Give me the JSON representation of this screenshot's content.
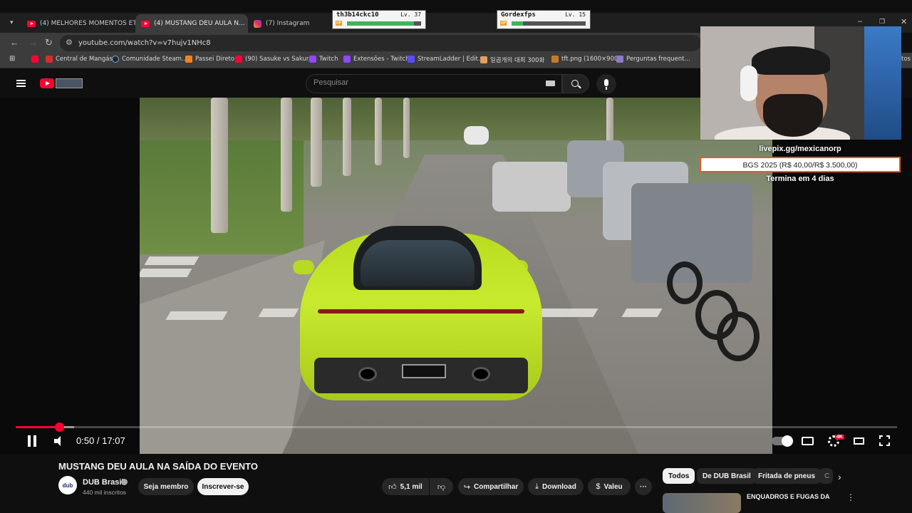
{
  "browser": {
    "tabs": [
      {
        "label": "(4) MELHORES MOMENTOS ET...",
        "favicon": "youtube-icon"
      },
      {
        "label": "(4) MUSTANG DEU AULA N...",
        "favicon": "youtube-icon"
      },
      {
        "label": "(7) Instagram",
        "favicon": "instagram-icon"
      }
    ],
    "url": "youtube.com/watch?v=v7hujv1NHc8",
    "bookmarks": [
      "Central de Mangás",
      "Comunidade Steam...",
      "Passei Direto",
      "(90) Sasuke vs Sakur...",
      "Twitch",
      "Extensões - Twitch",
      "StreamLadder | Edit...",
      "일곱개의 대죄 300화",
      "tft.png (1600×900)",
      "Perguntas frequent...",
      "tos"
    ]
  },
  "youtube": {
    "search_placeholder": "Pesquisar"
  },
  "overlay": {
    "pets": [
      {
        "name": "th3b14ckc10",
        "level": "Lv. 37",
        "hp_label": "HP",
        "hp_fraction": 0.9
      },
      {
        "name": "Gordexfps",
        "level": "Lv. 15",
        "hp_label": "HP",
        "hp_fraction": 0.15
      }
    ],
    "livepix_url": "livepix.gg/mexicanorp",
    "goal_text": "BGS 2025 (R$ 40,00/R$ 3.500,00)",
    "goal_ends": "Termina em 4 dias",
    "goal_color": "#e05a2a"
  },
  "player": {
    "time": "0:50 / 17:07",
    "progress_played_fraction": 0.049,
    "progress_loaded_fraction": 0.066,
    "quality_badge": "4K",
    "accent_color": "#ff0033"
  },
  "video": {
    "title": "MUSTANG DEU AULA NA SAÍDA DO EVENTO",
    "channel": "DUB Brasil",
    "channel_avatar_text": "dub",
    "subscribers": "440 mil inscritos",
    "join_label": "Seja membro",
    "subscribe_label": "Inscrever-se",
    "likes": "5,1 mil",
    "share_label": "Compartilhar",
    "download_label": "Download",
    "thanks_label": "Valeu",
    "more_label": "···"
  },
  "sidebar": {
    "chips": [
      "Todos",
      "De DUB Brasil",
      "Fritada de pneus",
      "C"
    ],
    "recommendation_title": "ENQUADROS E FUGAS DA"
  }
}
